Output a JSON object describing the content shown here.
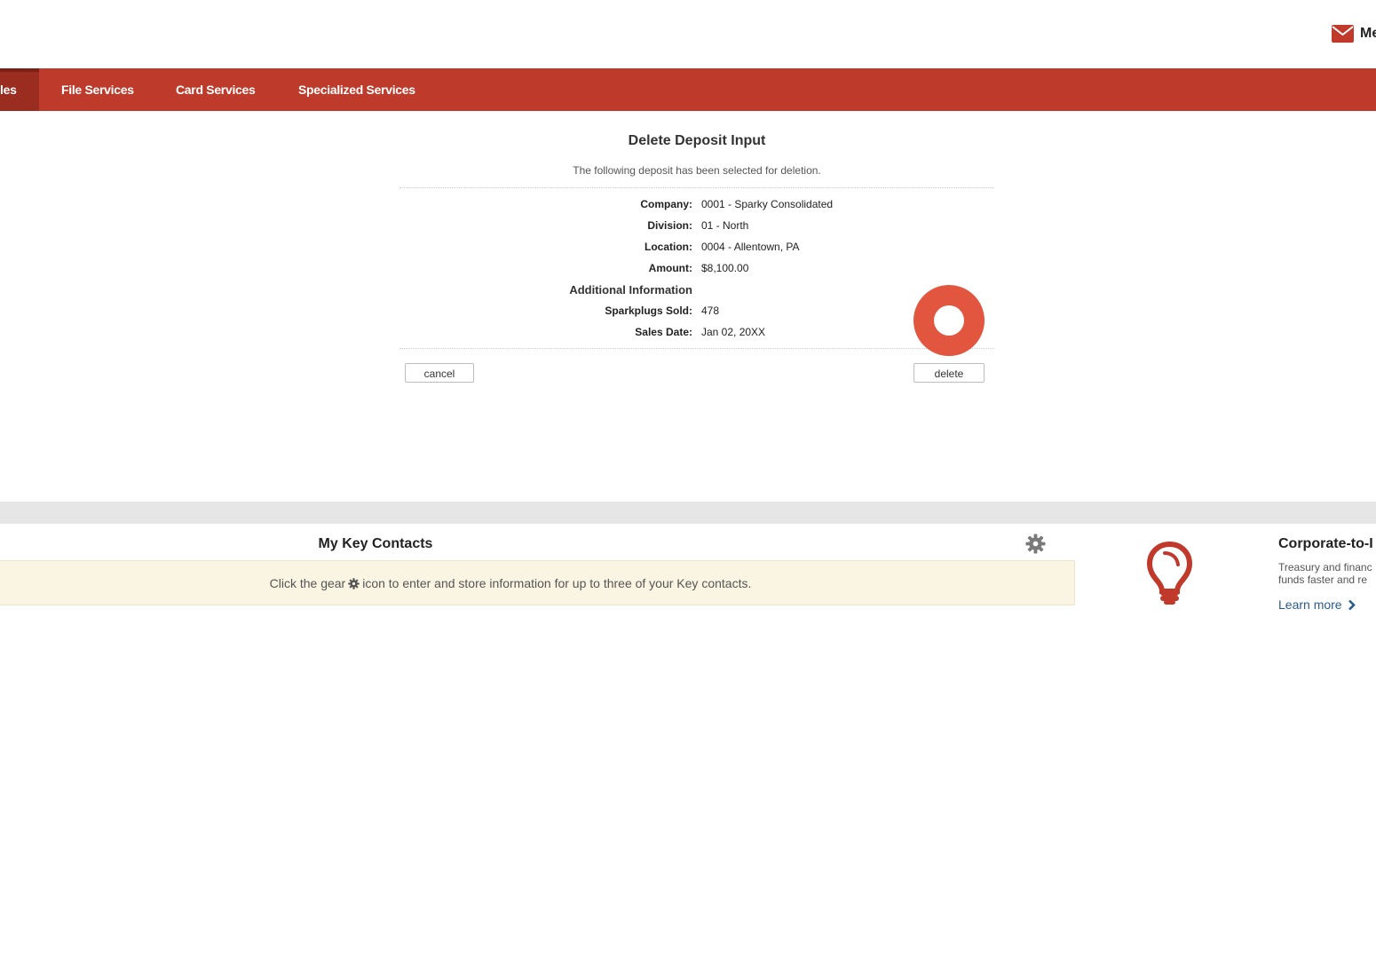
{
  "header": {
    "mail_label": "Me"
  },
  "nav": {
    "items": [
      {
        "label": "les"
      },
      {
        "label": "File Services"
      },
      {
        "label": "Card Services"
      },
      {
        "label": "Specialized Services"
      }
    ]
  },
  "main": {
    "title": "Delete Deposit Input",
    "subtitle": "The following deposit has been selected for deletion.",
    "fields": [
      {
        "label": "Company:",
        "value": "0001 - Sparky Consolidated"
      },
      {
        "label": "Division:",
        "value": "01 - North"
      },
      {
        "label": "Location:",
        "value": "0004 - Allentown, PA"
      },
      {
        "label": "Amount:",
        "value": "$8,100.00"
      }
    ],
    "additional_heading": "Additional Information",
    "additional_fields": [
      {
        "label": "Sparkplugs Sold:",
        "value": "478"
      },
      {
        "label": "Sales Date:",
        "value": "Jan 02, 20XX"
      }
    ],
    "cancel_label": "cancel",
    "delete_label": "delete"
  },
  "key_contacts": {
    "title": "My Key Contacts",
    "text_before": "Click the gear",
    "text_after": "icon to enter and store information for up to three of your Key contacts."
  },
  "promo": {
    "title": "Corporate-to-I",
    "text": "Treasury and financ\nfunds faster and re",
    "link": "Learn more"
  },
  "colors": {
    "brand_red": "#be3a2a",
    "nav_active": "#9b2c20",
    "click_marker": "#e2553f",
    "notice_bg": "#faf4e2",
    "link_blue": "#2a5d8c"
  },
  "icons": [
    "mail-icon",
    "gear-icon",
    "lightbulb-icon",
    "chevron-right-icon"
  ]
}
